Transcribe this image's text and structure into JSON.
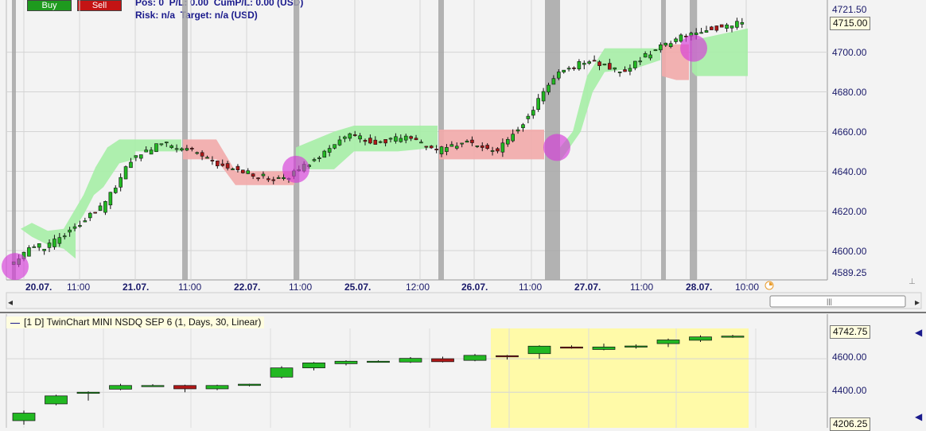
{
  "toolbar": {
    "buy_label": "Buy",
    "sell_label": "Sell"
  },
  "position_info": {
    "line1": "Pos: 0  P/L: 0.00  CumP/L: 0.00 (USD)",
    "line2": "Risk: n/a  Target: n/a (USD)"
  },
  "colors": {
    "bull": "#22b822",
    "bear": "#b01818",
    "green_band": "#a6eea6",
    "red_band": "#f2aaaa",
    "marker": "#d63ad8",
    "session": "#a6a6a6",
    "twin_highlight": "#fffaa8"
  },
  "main_panel": {
    "price_axis": [
      "4721.50",
      "4700.00",
      "4680.00",
      "4660.00",
      "4640.00",
      "4620.00",
      "4600.00",
      "4589.25"
    ],
    "current_price": "4715.00",
    "time_axis": [
      {
        "label": "20.07.",
        "day": true
      },
      {
        "label": "11:00",
        "day": false
      },
      {
        "label": "21.07.",
        "day": true
      },
      {
        "label": "11:00",
        "day": false
      },
      {
        "label": "22.07.",
        "day": true
      },
      {
        "label": "11:00",
        "day": false
      },
      {
        "label": "25.07.",
        "day": true
      },
      {
        "label": "12:00",
        "day": false
      },
      {
        "label": "26.07.",
        "day": true
      },
      {
        "label": "11:00",
        "day": false
      },
      {
        "label": "27.07.",
        "day": true
      },
      {
        "label": "11:00",
        "day": false
      },
      {
        "label": "28.07.",
        "day": true
      },
      {
        "label": "10:00",
        "day": false
      }
    ]
  },
  "twin_panel": {
    "title": "[1 D]  TwinChart MINI NSDQ SEP 6  (1, Days, 30, Linear)",
    "price_axis": [
      "4600.00",
      "4400.00"
    ],
    "top_price": "4742.75",
    "bottom_price": "4206.25"
  },
  "chart_data": [
    {
      "type": "candlestick",
      "title": "",
      "ylim": [
        4589.25,
        4721.5
      ],
      "x": [
        "20.07. 09:00",
        "20.07. 11:00",
        "20.07. 13:00",
        "20.07. 15:00",
        "21.07. 09:00",
        "21.07. 11:00",
        "21.07. 13:00",
        "21.07. 15:00",
        "22.07. 09:00",
        "22.07. 11:00",
        "22.07. 13:00",
        "22.07. 15:00",
        "25.07. 09:00",
        "25.07. 12:00",
        "25.07. 15:00",
        "26.07. 09:00",
        "26.07. 11:00",
        "26.07. 13:00",
        "26.07. 15:00",
        "27.07. 09:00",
        "27.07. 11:00",
        "27.07. 13:00",
        "28.07. 09:00",
        "28.07. 10:00"
      ],
      "ohlc": [
        [
          4592,
          4608,
          4590,
          4605
        ],
        [
          4600,
          4612,
          4597,
          4610
        ],
        [
          4610,
          4626,
          4605,
          4622
        ],
        [
          4620,
          4650,
          4618,
          4646
        ],
        [
          4646,
          4658,
          4644,
          4654
        ],
        [
          4654,
          4658,
          4645,
          4650
        ],
        [
          4650,
          4654,
          4640,
          4643
        ],
        [
          4643,
          4650,
          4630,
          4638
        ],
        [
          4638,
          4641,
          4633,
          4636
        ],
        [
          4636,
          4650,
          4628,
          4646
        ],
        [
          4646,
          4662,
          4640,
          4658
        ],
        [
          4658,
          4668,
          4652,
          4655
        ],
        [
          4655,
          4663,
          4650,
          4657
        ],
        [
          4657,
          4660,
          4645,
          4650
        ],
        [
          4650,
          4658,
          4644,
          4655
        ],
        [
          4655,
          4660,
          4642,
          4650
        ],
        [
          4650,
          4675,
          4640,
          4668
        ],
        [
          4668,
          4698,
          4660,
          4690
        ],
        [
          4690,
          4700,
          4684,
          4696
        ],
        [
          4696,
          4708,
          4685,
          4690
        ],
        [
          4690,
          4705,
          4680,
          4700
        ],
        [
          4700,
          4712,
          4695,
          4708
        ],
        [
          4708,
          4720,
          4704,
          4712
        ],
        [
          4712,
          4721,
          4708,
          4715
        ]
      ]
    },
    {
      "type": "candlestick",
      "title": "[1 D]  TwinChart MINI NSDQ SEP 6  (1, Days, 30, Linear)",
      "ylim": [
        4206.25,
        4742.75
      ],
      "x": [
        "1",
        "2",
        "3",
        "4",
        "5",
        "6",
        "7",
        "8",
        "9",
        "10",
        "11",
        "12",
        "13",
        "14",
        "15",
        "16",
        "17",
        "18",
        "19",
        "20",
        "21",
        "22",
        "23"
      ],
      "ohlc": [
        [
          4230,
          4290,
          4206,
          4275
        ],
        [
          4330,
          4385,
          4322,
          4378
        ],
        [
          4395,
          4405,
          4350,
          4400
        ],
        [
          4418,
          4450,
          4412,
          4440
        ],
        [
          4440,
          4448,
          4432,
          4440
        ],
        [
          4440,
          4445,
          4400,
          4420
        ],
        [
          4420,
          4445,
          4412,
          4440
        ],
        [
          4440,
          4450,
          4435,
          4448
        ],
        [
          4490,
          4555,
          4482,
          4545
        ],
        [
          4545,
          4580,
          4530,
          4575
        ],
        [
          4570,
          4590,
          4560,
          4585
        ],
        [
          4583,
          4590,
          4578,
          4585
        ],
        [
          4580,
          4610,
          4575,
          4602
        ],
        [
          4600,
          4612,
          4578,
          4582
        ],
        [
          4590,
          4628,
          4585,
          4620
        ],
        [
          4618,
          4622,
          4595,
          4617
        ],
        [
          4630,
          4680,
          4600,
          4675
        ],
        [
          4670,
          4680,
          4660,
          4665
        ],
        [
          4655,
          4690,
          4650,
          4670
        ],
        [
          4670,
          4685,
          4660,
          4676
        ],
        [
          4690,
          4720,
          4670,
          4712
        ],
        [
          4710,
          4740,
          4700,
          4730
        ],
        [
          4732,
          4742,
          4725,
          4735
        ]
      ]
    }
  ]
}
